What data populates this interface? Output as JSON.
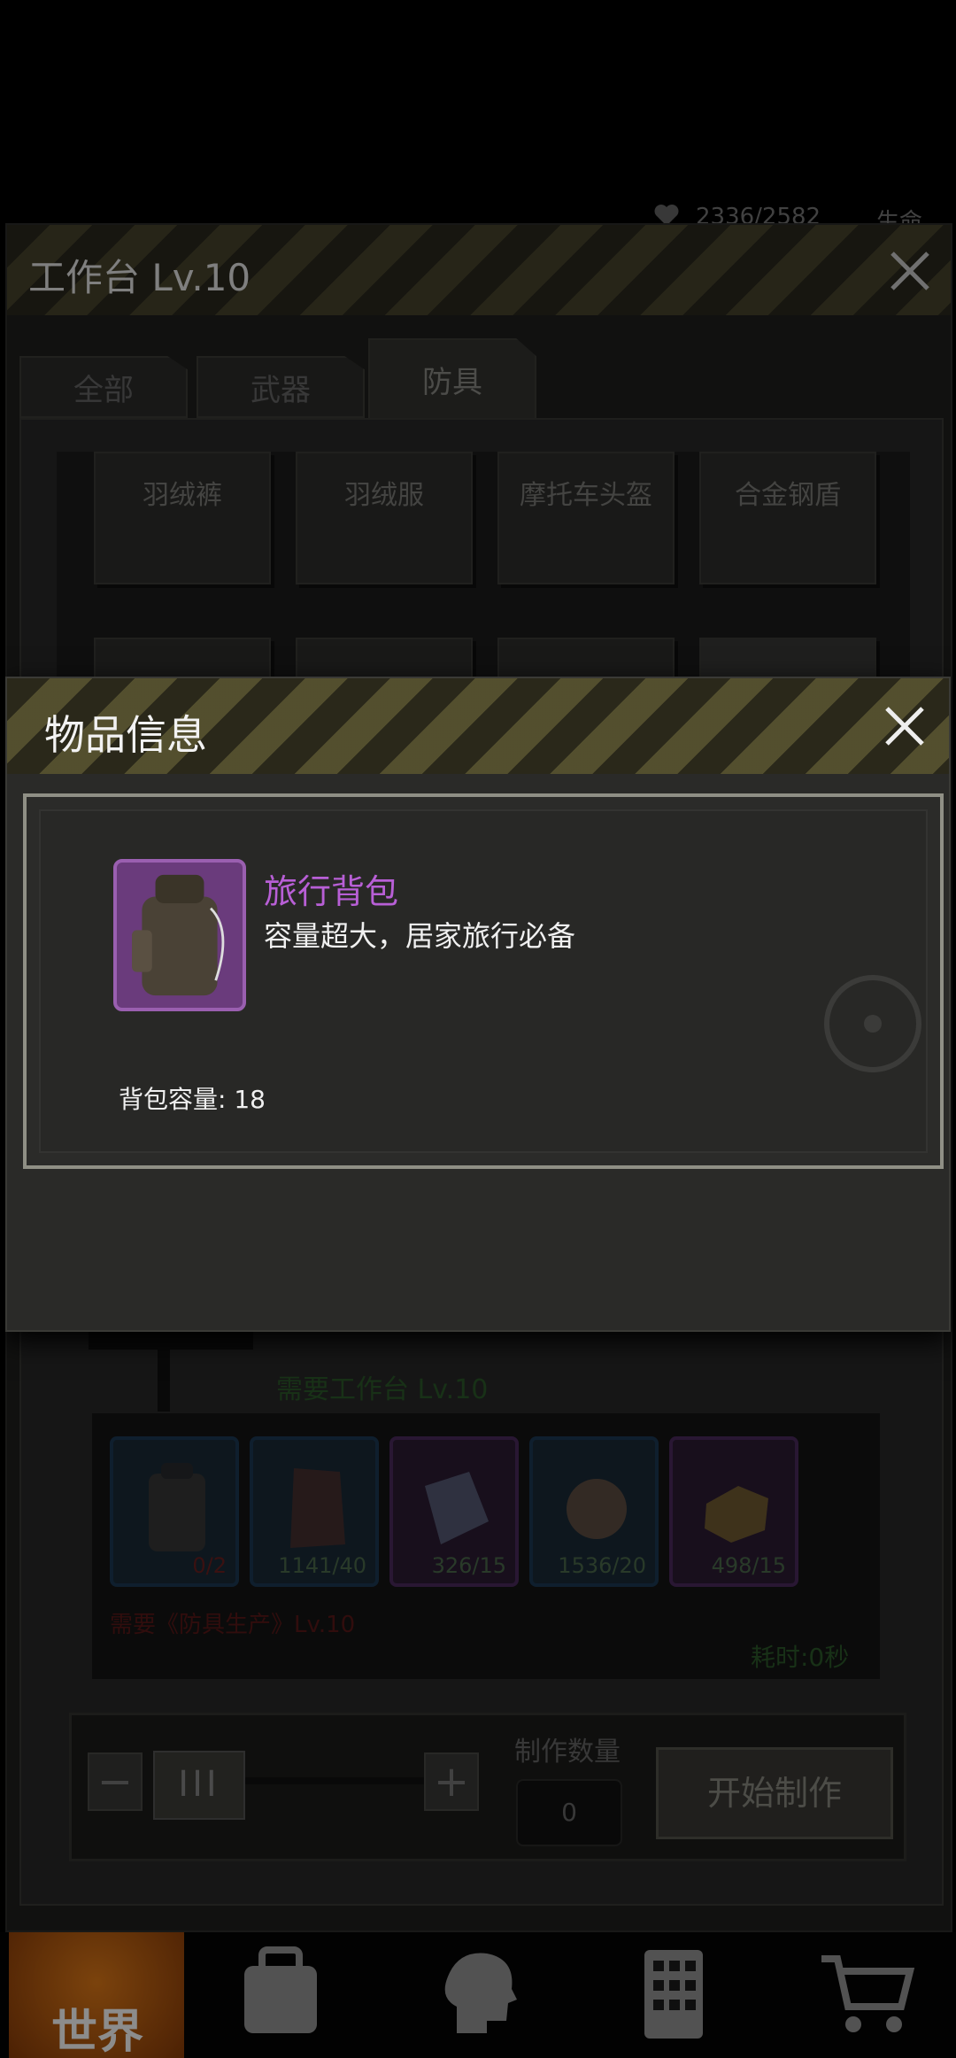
{
  "status": {
    "hp": "2336/2582",
    "life_label": "生命"
  },
  "workbench": {
    "title": "工作台 Lv.10",
    "tabs": [
      {
        "label": "全部",
        "active": false
      },
      {
        "label": "武器",
        "active": false
      },
      {
        "label": "防具",
        "active": true
      }
    ],
    "items_row1": [
      "羽绒裤",
      "羽绒服",
      "摩托车头盔",
      "合金钢盾"
    ],
    "requirement_bench": "需要工作台 Lv.10",
    "materials": [
      {
        "count": "0/2",
        "frame": "blue",
        "icon": "backpack-icon",
        "insufficient": true
      },
      {
        "count": "1141/40",
        "frame": "blue",
        "icon": "leather-icon",
        "insufficient": false
      },
      {
        "count": "326/15",
        "frame": "purple",
        "icon": "cloth-icon",
        "insufficient": false
      },
      {
        "count": "1536/20",
        "frame": "blue",
        "icon": "yarn-ball-icon",
        "insufficient": false
      },
      {
        "count": "498/15",
        "frame": "purple",
        "icon": "gold-block-icon",
        "insufficient": false
      }
    ],
    "requirement_skill": "需要《防具生产》Lv.10",
    "time_cost": "耗时:0秒",
    "quantity_label": "制作数量",
    "quantity_value": "0",
    "start_button": "开始制作"
  },
  "nav": {
    "world_label": "世界",
    "icons": [
      "backpack-icon",
      "head-skill-icon",
      "building-icon",
      "shopping-cart-icon"
    ]
  },
  "dialog": {
    "title": "物品信息",
    "item_name": "旅行背包",
    "item_description": "容量超大，居家旅行必备",
    "item_stat": "背包容量: 18",
    "item_frame_color": "#9a5fb0",
    "item_name_color": "#b85fd6"
  }
}
